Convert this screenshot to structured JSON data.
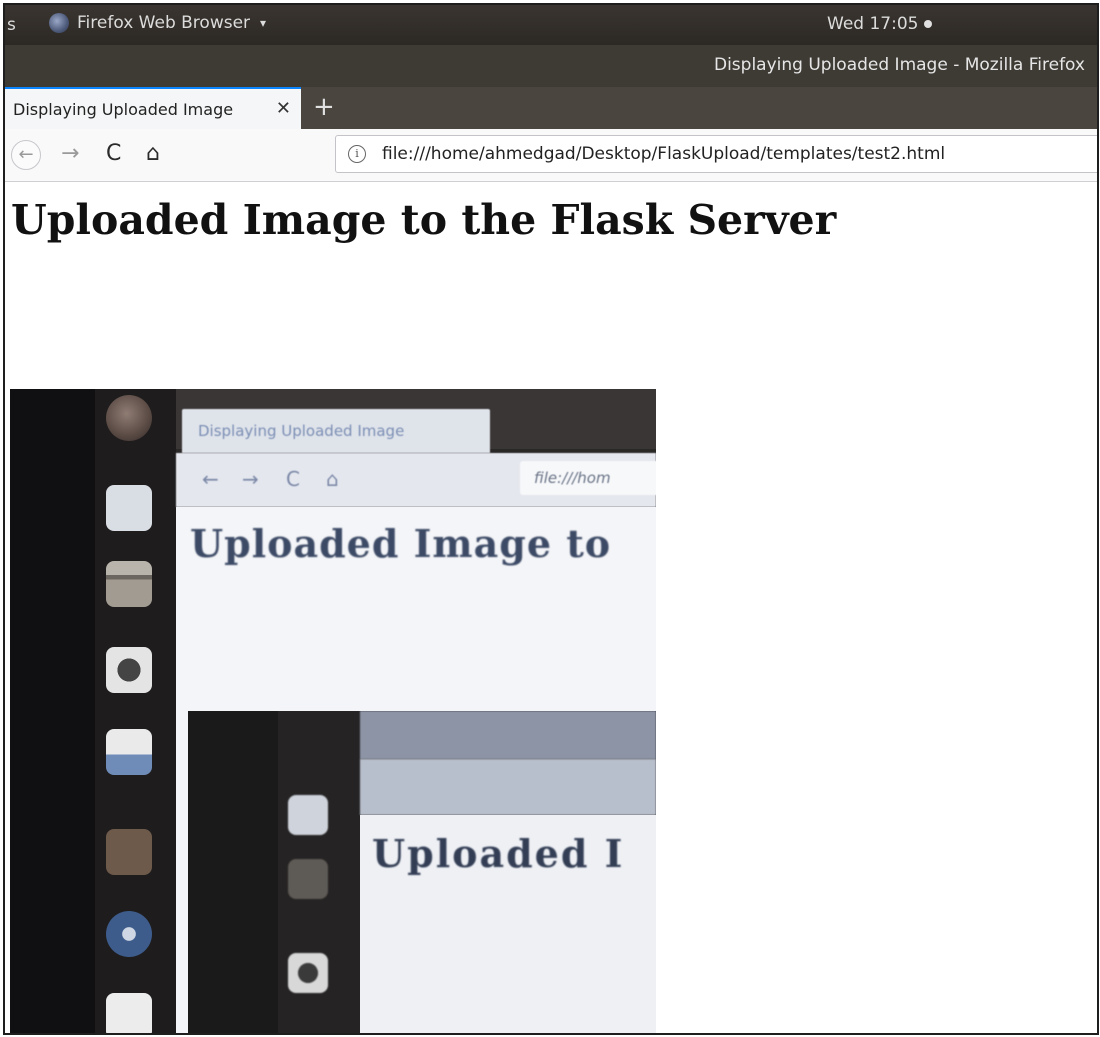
{
  "topbar": {
    "activities": "s",
    "app_menu_label": "Firefox Web Browser",
    "app_menu_caret": "▾",
    "clock": "Wed 17:05"
  },
  "window": {
    "title": "Displaying Uploaded Image - Mozilla Firefox"
  },
  "tabs": [
    {
      "label": "Displaying Uploaded Image",
      "close": "✕",
      "active": true
    }
  ],
  "new_tab_symbol": "+",
  "toolbar": {
    "back": "←",
    "forward": "→",
    "reload": "C",
    "home": "⌂"
  },
  "urlbar": {
    "info_icon": "i",
    "url": "file:///home/ahmedgad/Desktop/FlaskUpload/templates/test2.html"
  },
  "page": {
    "heading": "Uploaded Image to the Flask Server"
  },
  "uploaded_image": {
    "inner_tab_label": "Displaying Uploaded Image",
    "inner_url": "file:///hom",
    "inner_heading": "Uploaded Image to",
    "nested_heading": "Uploaded I"
  },
  "colors": {
    "tab_accent": "#0a84ff",
    "panel_bg": "#2c2824",
    "tabstrip_bg": "#4a453f"
  }
}
